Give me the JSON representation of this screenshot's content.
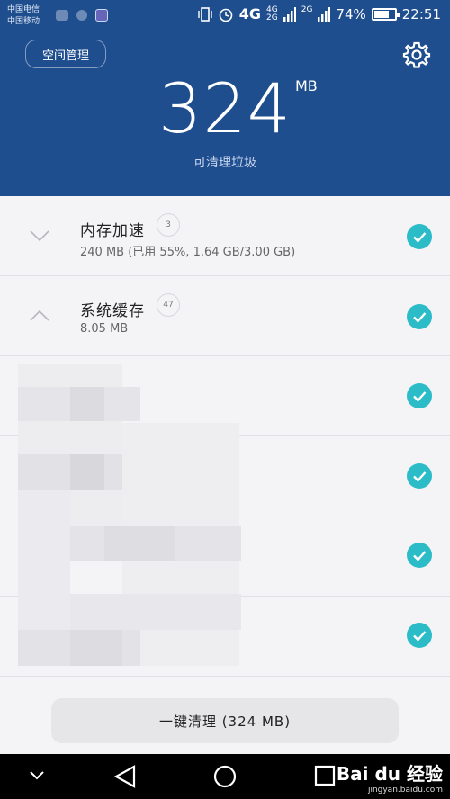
{
  "status_bar": {
    "carrier1": "中国电信",
    "carrier2": "中国移动",
    "network": "4G",
    "sig1_top": "4G",
    "sig1_bot": "2G",
    "sig2_top": "2G",
    "battery": "74%",
    "battery_level": 0.74,
    "time": "22:51"
  },
  "header": {
    "space_button": "空间管理",
    "junk_size": "324",
    "junk_unit": "MB",
    "subtitle": "可清理垃圾"
  },
  "list": [
    {
      "title": "内存加速",
      "count": "3",
      "detail": "240 MB (已用 55%, 1.64 GB/3.00 GB)",
      "expanded": false,
      "checked": true
    },
    {
      "title": "系统缓存",
      "count": "47",
      "detail": "8.05 MB",
      "expanded": true,
      "checked": true
    },
    {
      "checked": true
    },
    {
      "checked": true
    },
    {
      "checked": true
    },
    {
      "checked": true
    }
  ],
  "colors": {
    "header_bg": "#1f4e8f",
    "check": "#2bbcc8"
  },
  "clean_button": "一键清理 (324 MB)",
  "watermark": {
    "brand": "Bai du 经验",
    "url": "jingyan.baidu.com"
  }
}
